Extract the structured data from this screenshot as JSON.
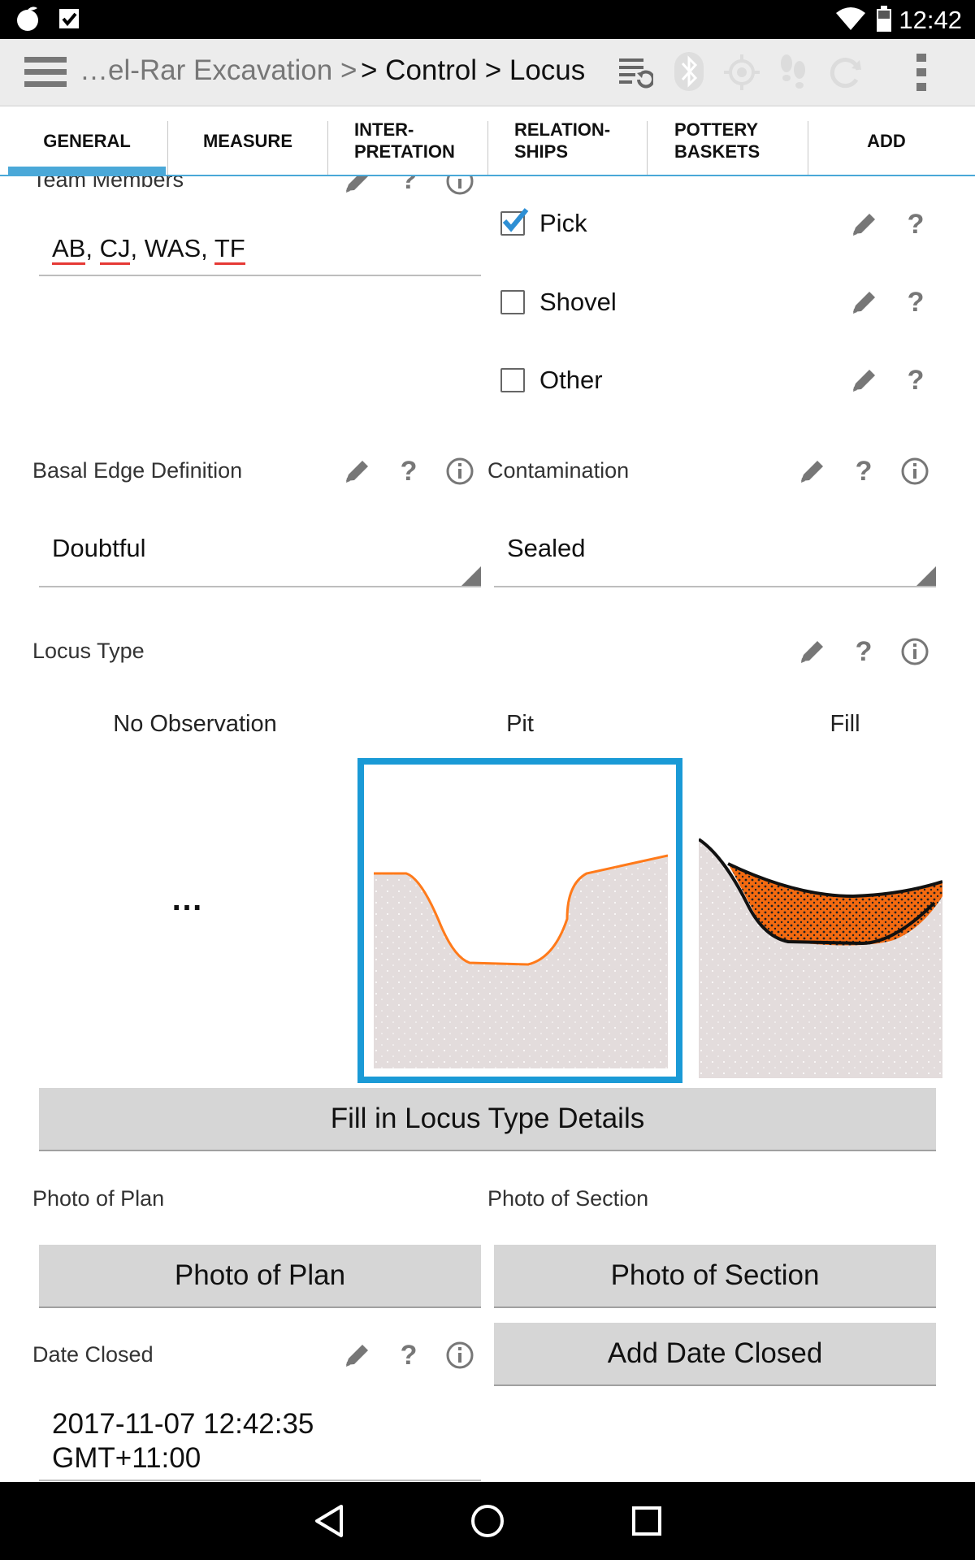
{
  "status_bar": {
    "time": "12:42"
  },
  "app_bar": {
    "breadcrumb_left": "…el-Rar Excavation >",
    "breadcrumb_right": "> Control > Locus"
  },
  "tabs": [
    {
      "label": "GENERAL"
    },
    {
      "label": "MEASURE"
    },
    {
      "label": "INTER-\nPRETATION"
    },
    {
      "label": "RELATION-\nSHIPS"
    },
    {
      "label": "POTTERY\nBASKETS"
    },
    {
      "label": "ADD"
    }
  ],
  "team_members": {
    "label": "Team Members",
    "value_parts": [
      "AB",
      ", ",
      "CJ",
      ", WAS, ",
      "TF"
    ]
  },
  "tools": [
    {
      "label": "Pick",
      "checked": true
    },
    {
      "label": "Shovel",
      "checked": false
    },
    {
      "label": "Other",
      "checked": false
    }
  ],
  "basal_edge": {
    "label": "Basal Edge Definition",
    "value": "Doubtful"
  },
  "contamination": {
    "label": "Contamination",
    "value": "Sealed"
  },
  "locus_type": {
    "label": "Locus Type",
    "options": [
      "No Observation",
      "Pit",
      "Fill"
    ],
    "selected": "Pit",
    "no_observation_glyph": "…"
  },
  "buttons": {
    "fill_details": "Fill in Locus Type Details",
    "photo_plan": "Photo of Plan",
    "photo_section": "Photo of Section",
    "add_date_closed": "Add Date Closed"
  },
  "photo_plan_label": "Photo of Plan",
  "photo_section_label": "Photo of Section",
  "date_closed": {
    "label": "Date Closed",
    "value_line1": "2017-11-07 12:42:35",
    "value_line2": "GMT+11:00"
  },
  "icons": [
    "menu-icon",
    "sync-icon",
    "bluetooth-icon",
    "gps-icon",
    "footsteps-icon",
    "refresh-icon",
    "overflow-icon",
    "pencil-icon",
    "help-icon",
    "info-icon"
  ],
  "colors": {
    "accent": "#4aa8d8",
    "selection_border": "#1a9ad6",
    "pit_outline": "#ff7a1a",
    "fill_orange": "#f46a10"
  }
}
